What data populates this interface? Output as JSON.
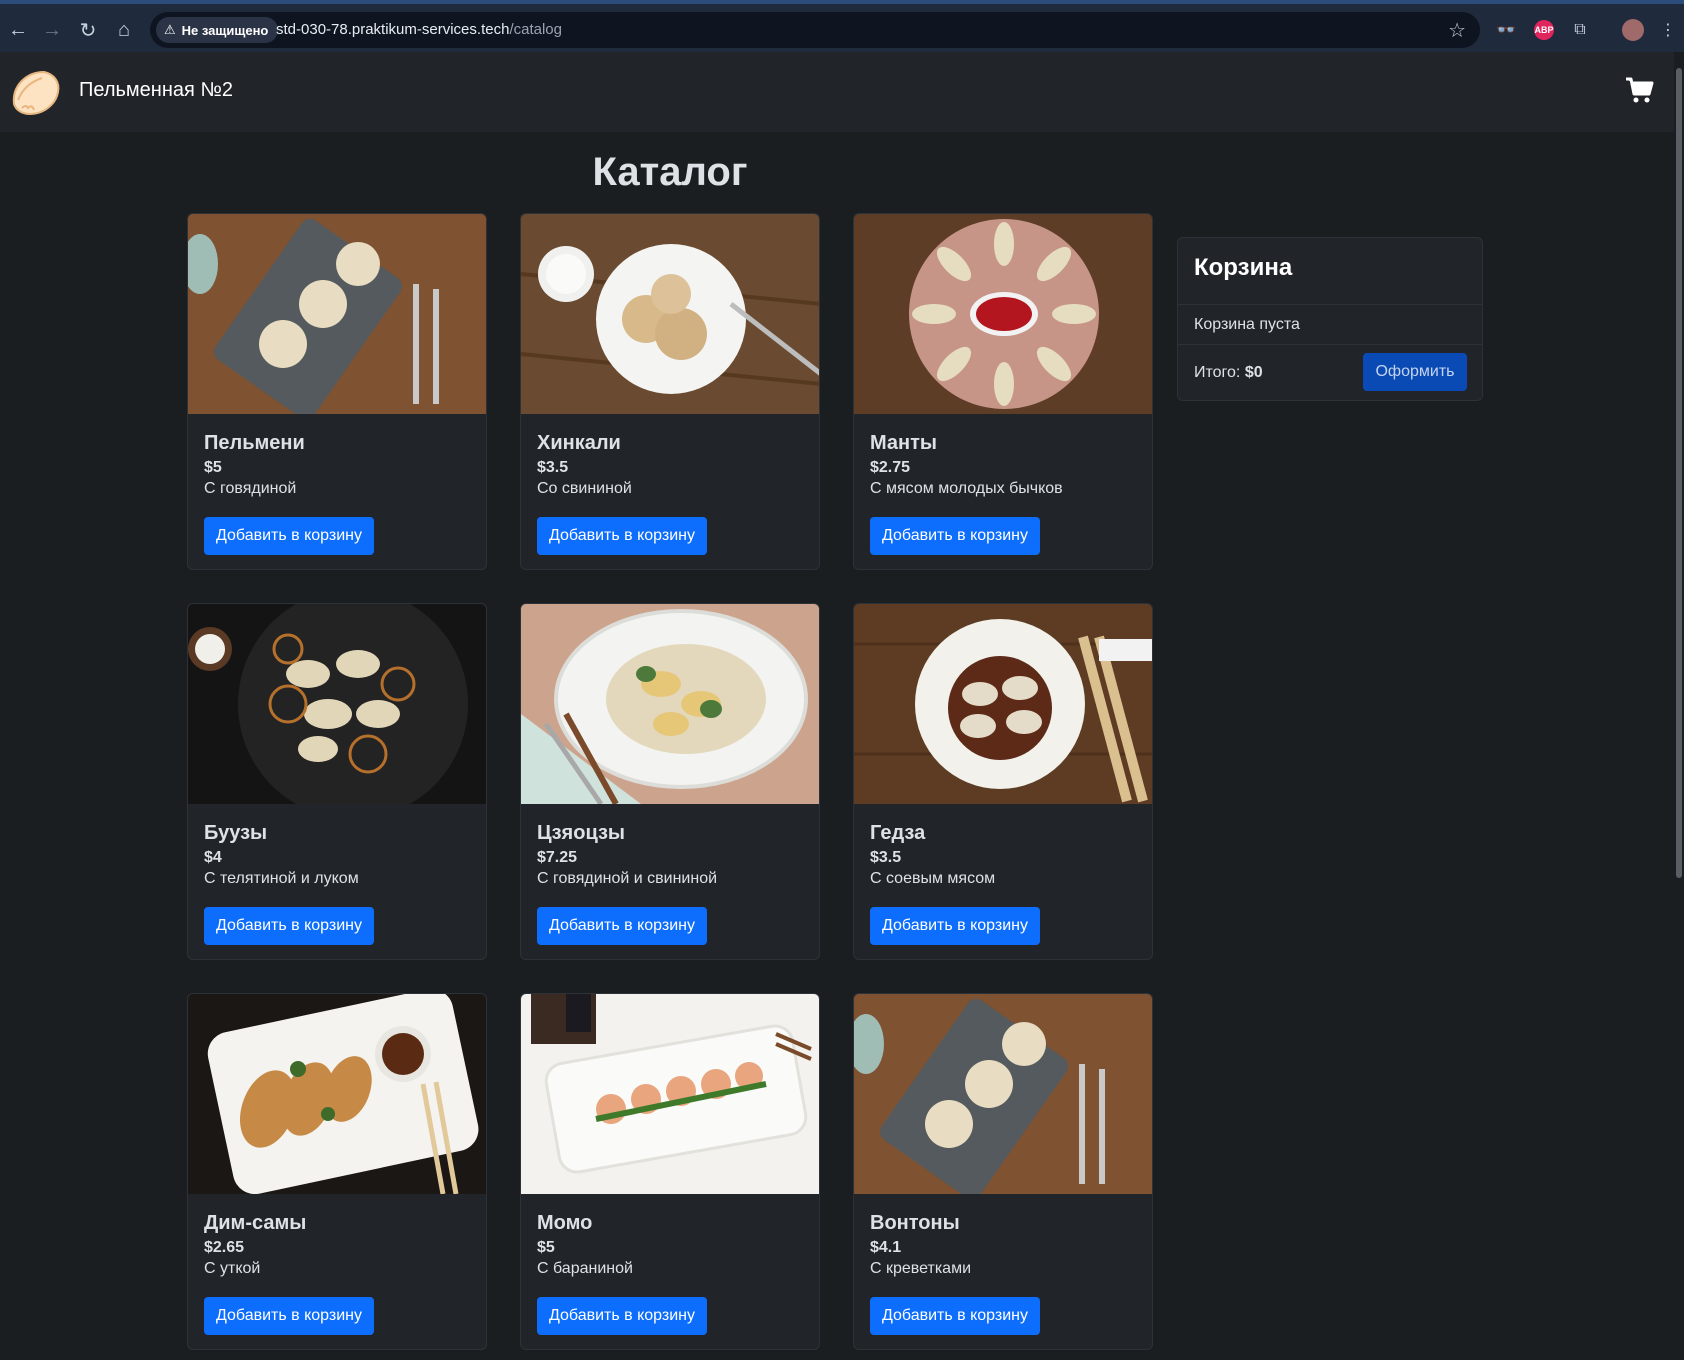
{
  "browser": {
    "security_label": "Не защищено",
    "url_host": "std-030-78.praktikum-services.tech",
    "url_path": "/catalog",
    "icons": [
      "back-icon",
      "forward-icon",
      "reload-icon",
      "home-icon",
      "warning-icon",
      "star-icon",
      "extension-icon",
      "abp-icon",
      "puzzle-icon",
      "profile-icon",
      "menu-icon"
    ],
    "abp_text": "ABP"
  },
  "header": {
    "brand": "Пельменная №2"
  },
  "page": {
    "title": "Каталог"
  },
  "products": [
    {
      "name": "Пельмени",
      "price": "$5",
      "desc": "С говядиной",
      "button": "Добавить в корзину"
    },
    {
      "name": "Хинкали",
      "price": "$3.5",
      "desc": "Со свининой",
      "button": "Добавить в корзину"
    },
    {
      "name": "Манты",
      "price": "$2.75",
      "desc": "С мясом молодых бычков",
      "button": "Добавить в корзину"
    },
    {
      "name": "Буузы",
      "price": "$4",
      "desc": "С телятиной и луком",
      "button": "Добавить в корзину"
    },
    {
      "name": "Цзяоцзы",
      "price": "$7.25",
      "desc": "С говядиной и свининой",
      "button": "Добавить в корзину"
    },
    {
      "name": "Гедза",
      "price": "$3.5",
      "desc": "С соевым мясом",
      "button": "Добавить в корзину"
    },
    {
      "name": "Дим-самы",
      "price": "$2.65",
      "desc": "С уткой",
      "button": "Добавить в корзину"
    },
    {
      "name": "Момо",
      "price": "$5",
      "desc": "С бараниной",
      "button": "Добавить в корзину"
    },
    {
      "name": "Вонтоны",
      "price": "$4.1",
      "desc": "С креветками",
      "button": "Добавить в корзину"
    }
  ],
  "cart": {
    "title": "Корзина",
    "empty_text": "Корзина пуста",
    "total_label": "Итого:",
    "total_value": "$0",
    "checkout": "Оформить"
  },
  "colors": {
    "page_bg": "#1b1e21",
    "card_bg": "#212529",
    "primary": "#0d6efd"
  }
}
